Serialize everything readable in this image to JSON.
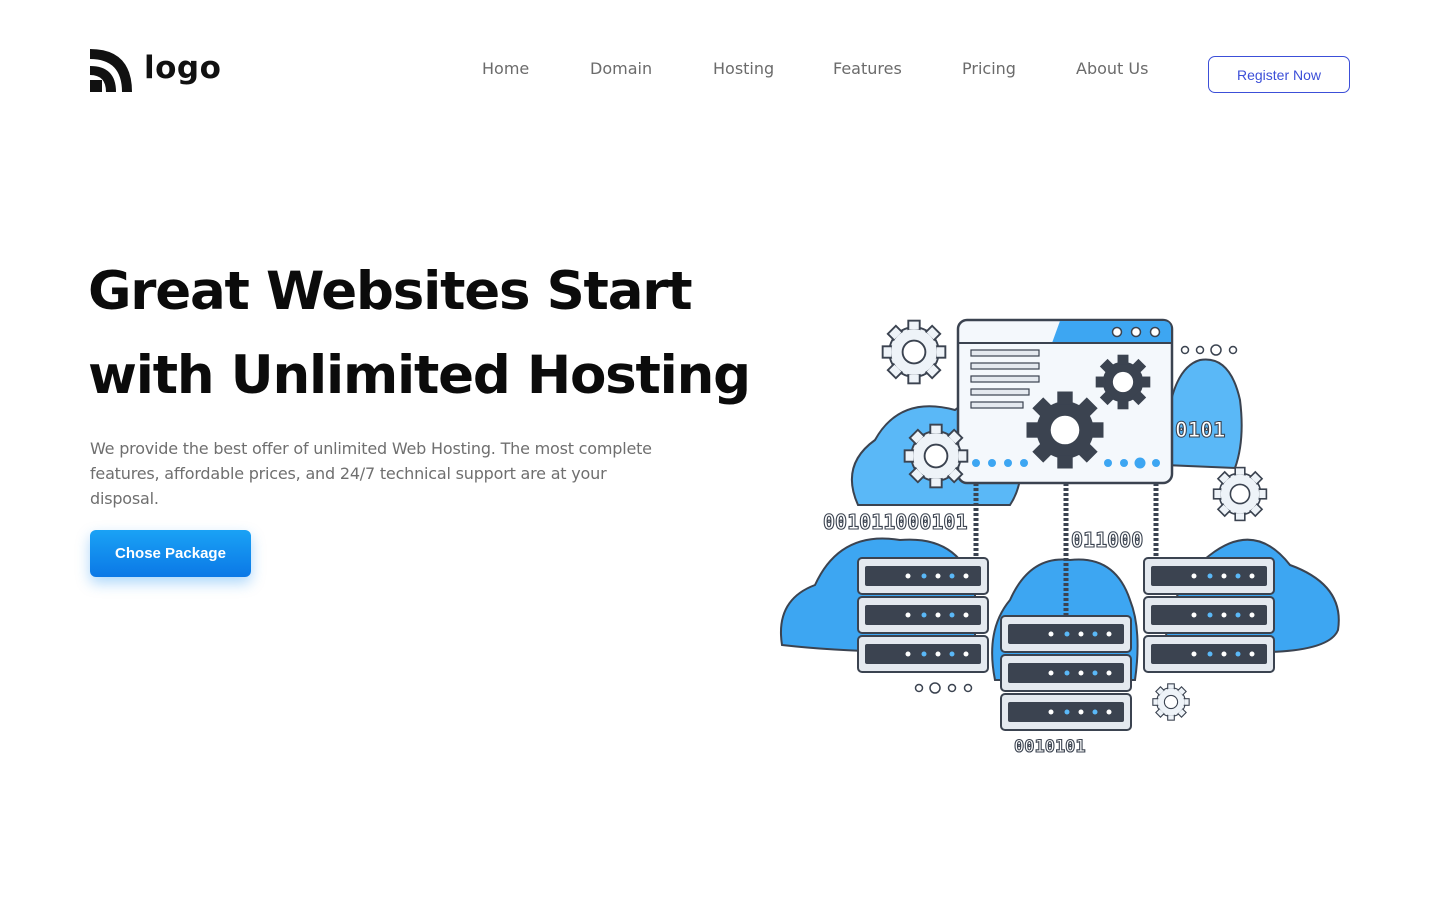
{
  "brand": {
    "logo_text": "logo",
    "icon": "logo-mark-icon"
  },
  "nav": {
    "items": [
      {
        "label": "Home"
      },
      {
        "label": "Domain"
      },
      {
        "label": "Hosting"
      },
      {
        "label": "Features"
      },
      {
        "label": "Pricing"
      },
      {
        "label": "About Us"
      }
    ],
    "register_label": "Register Now"
  },
  "hero": {
    "title_line1": "Great Websites Start",
    "title_line2": "with Unlimited Hosting",
    "description": "We provide the best offer of unlimited Web Hosting. The most complete features, affordable prices, and 24/7 technical support are at your disposal.",
    "cta_label": "Chose Package"
  },
  "illustration": {
    "binary_top_right": "0101",
    "binary_left": "001011000101",
    "binary_center": "011000",
    "binary_bottom": "0010101"
  },
  "colors": {
    "accent_blue": "#3c4fd8",
    "cta_blue": "#0b78e6",
    "cloud_blue": "#5ab8f7",
    "dark_slate": "#3b4350"
  }
}
